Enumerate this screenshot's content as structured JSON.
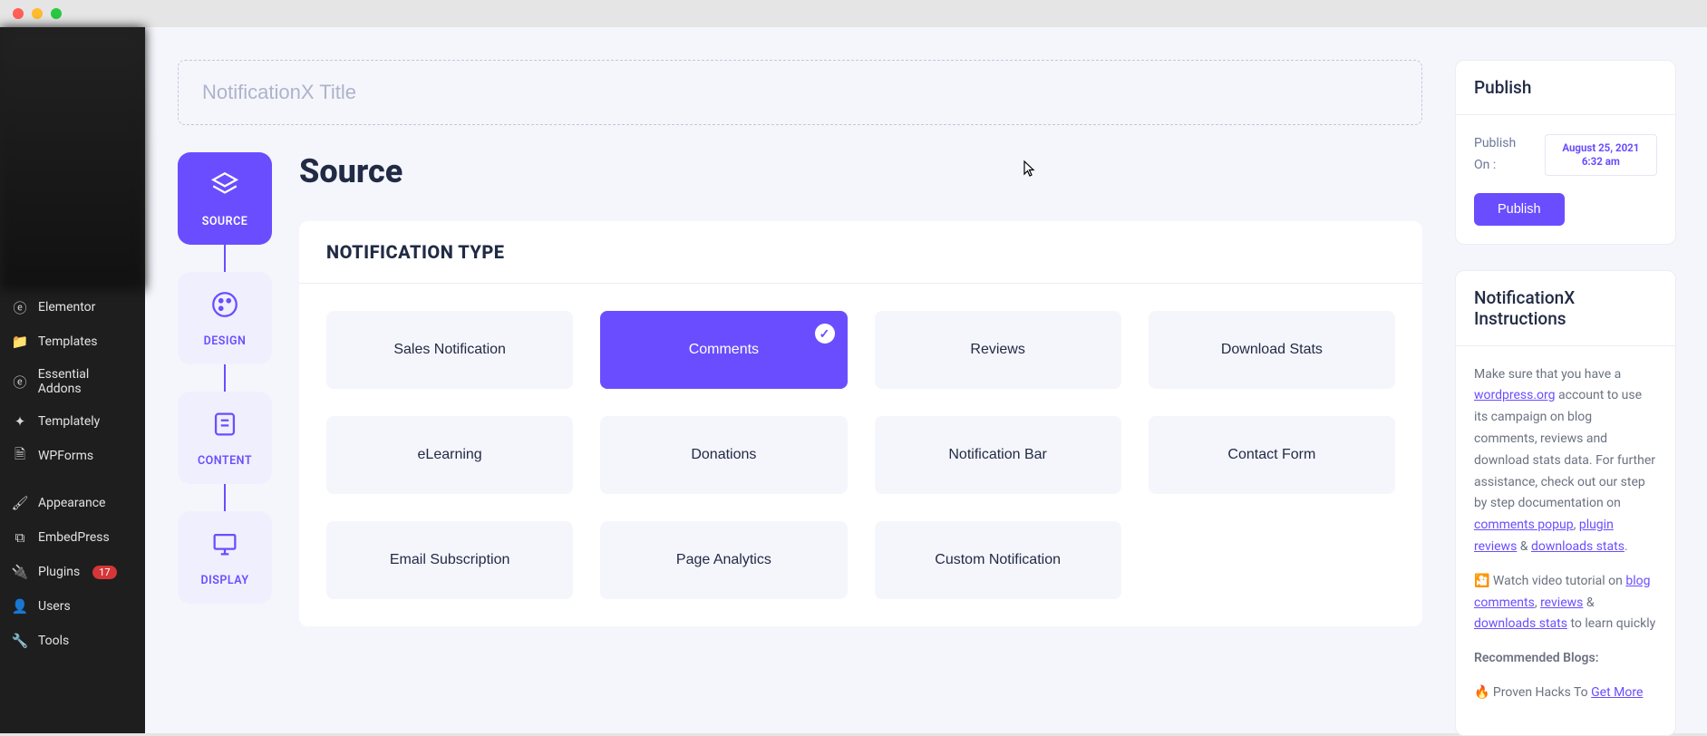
{
  "admin_sidebar": {
    "items": [
      {
        "label": "Elementor"
      },
      {
        "label": "Templates"
      },
      {
        "label": "Essential Addons"
      },
      {
        "label": "Templately"
      },
      {
        "label": "WPForms"
      },
      {
        "label": "Appearance"
      },
      {
        "label": "EmbedPress"
      },
      {
        "label": "Plugins",
        "badge": "17"
      },
      {
        "label": "Users"
      },
      {
        "label": "Tools"
      }
    ]
  },
  "title_field": {
    "placeholder": "NotificationX Title",
    "value": ""
  },
  "steps": [
    {
      "key": "source",
      "label": "SOURCE"
    },
    {
      "key": "design",
      "label": "DESIGN"
    },
    {
      "key": "content",
      "label": "CONTENT"
    },
    {
      "key": "display",
      "label": "DISPLAY"
    }
  ],
  "active_step": "source",
  "panel": {
    "title": "Source",
    "section_heading": "NOTIFICATION TYPE",
    "types": [
      "Sales Notification",
      "Comments",
      "Reviews",
      "Download Stats",
      "eLearning",
      "Donations",
      "Notification Bar",
      "Contact Form",
      "Email Subscription",
      "Page Analytics",
      "Custom Notification"
    ],
    "selected_type": "Comments"
  },
  "publish_box": {
    "heading": "Publish",
    "label": "Publish On :",
    "date": "August 25, 2021 6:32 am",
    "button": "Publish"
  },
  "instructions": {
    "heading": "NotificationX Instructions",
    "p1_pre": "Make sure that you have a ",
    "p1_link1": "wordpress.org",
    "p1_post": " account to use its campaign on blog comments, reviews and download stats data. For further assistance, check out our step by step documentation on ",
    "p1_link2": "comments popup",
    "p1_sep1": ", ",
    "p1_link3": "plugin reviews",
    "p1_sep2": " & ",
    "p1_link4": "downloads stats",
    "p1_end": ".",
    "p2_icon": "🎦",
    "p2_pre": " Watch video tutorial on ",
    "p2_link1": "blog comments",
    "p2_sep1": ", ",
    "p2_link2": "reviews",
    "p2_sep2": " & ",
    "p2_link3": "downloads stats",
    "p2_post": " to learn quickly",
    "rec_heading": "Recommended Blogs:",
    "p3_icon": "🔥",
    "p3_pre": " Proven Hacks To ",
    "p3_link": "Get More"
  }
}
